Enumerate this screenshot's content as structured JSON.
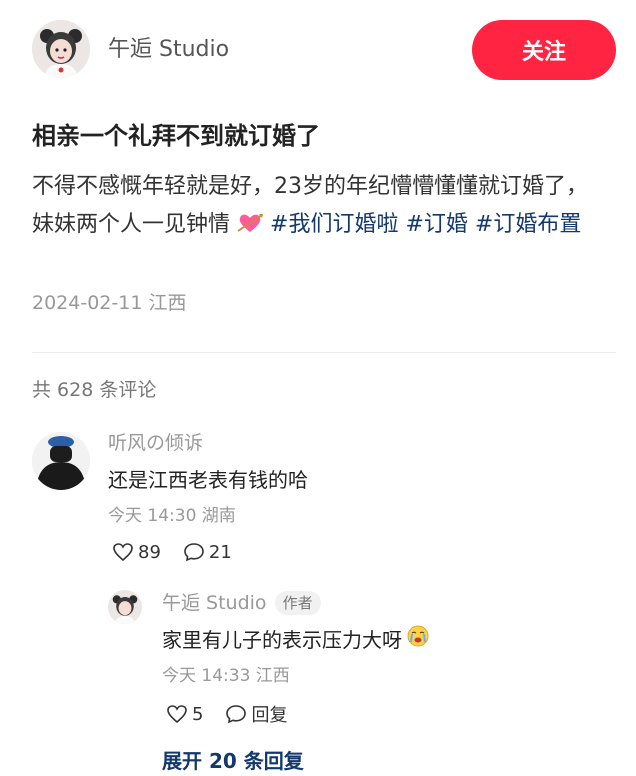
{
  "author": {
    "name": "午逅 Studio",
    "follow_label": "关注"
  },
  "post": {
    "title": "相亲一个礼拜不到就订婚了",
    "body_text": "不得不感慨年轻就是好，23岁的年纪懵懵懂懂就订婚了，妹妹两个人一见钟情",
    "tags": [
      "#我们订婚啦",
      "#订婚",
      "#订婚布置"
    ],
    "date_location": "2024-02-11 江西"
  },
  "comments_header": "共 628 条评论",
  "comment": {
    "user": "听风の倾诉",
    "text": "还是江西老表有钱的哈",
    "meta": "今天 14:30 湖南",
    "likes": "89",
    "replies": "21"
  },
  "reply": {
    "user": "午逅 Studio",
    "badge": "作者",
    "text": "家里有儿子的表示压力大呀",
    "meta": "今天 14:33 江西",
    "likes": "5",
    "reply_label": "回复"
  },
  "expand_label": "展开 20 条回复",
  "colors": {
    "accent_red": "#ff2442",
    "tag_blue": "#13386c"
  }
}
